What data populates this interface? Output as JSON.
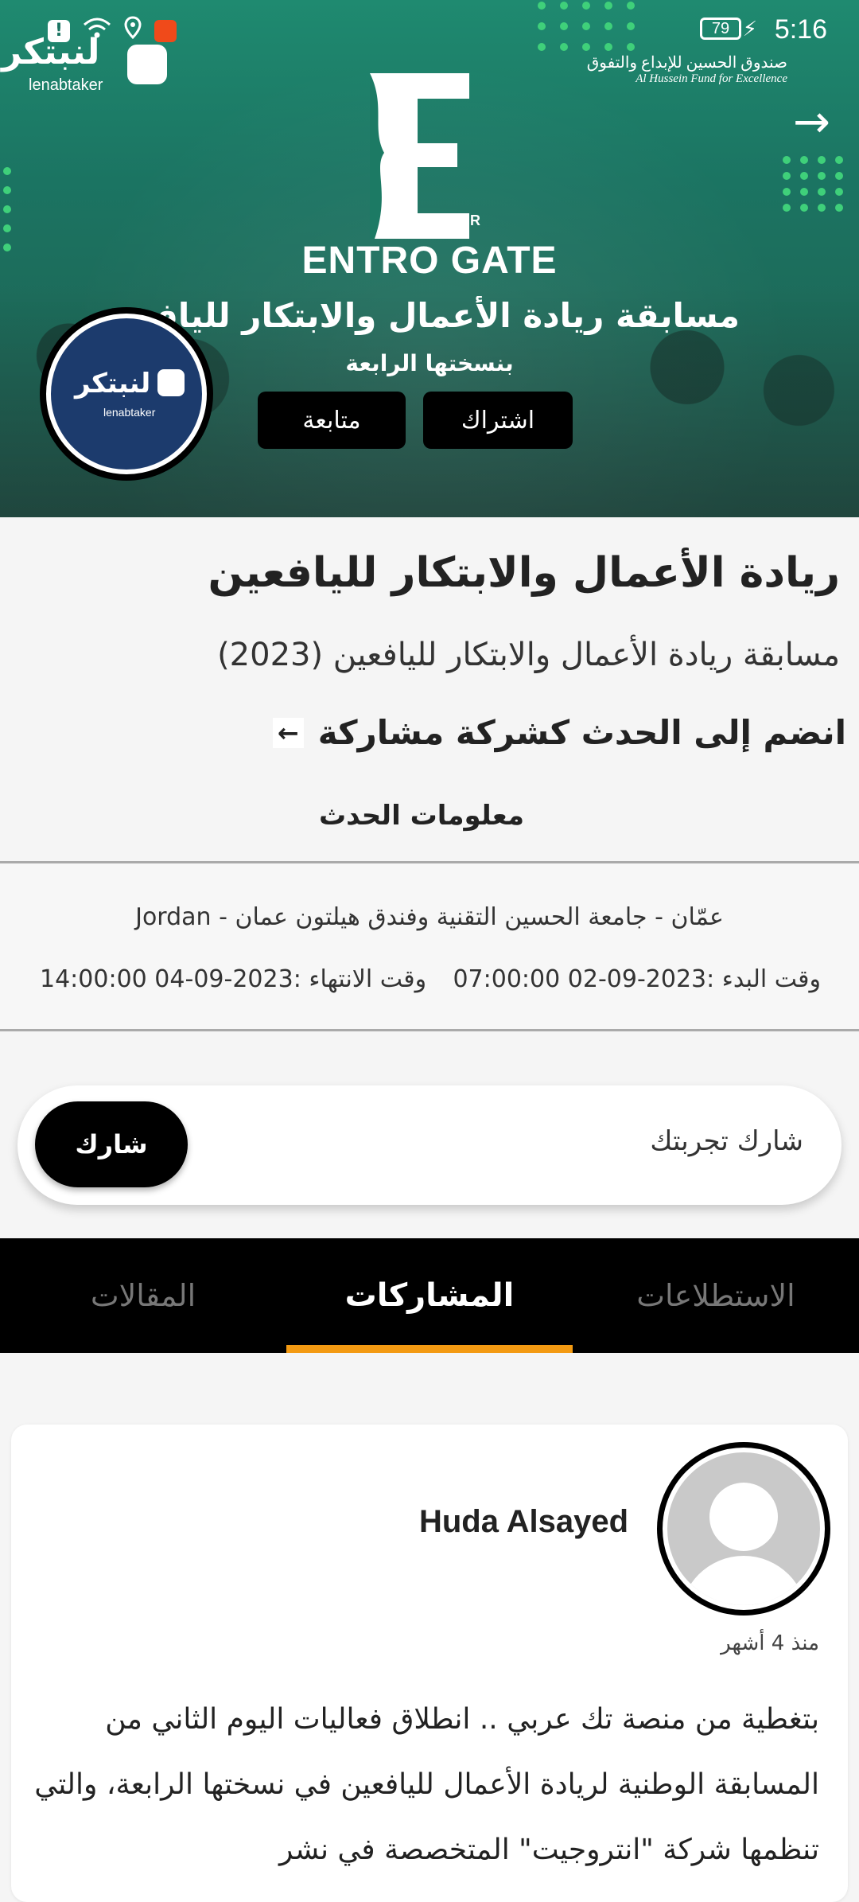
{
  "status_bar": {
    "time": "5:16",
    "battery": "79"
  },
  "hero": {
    "brand_ar": "لنبتكر",
    "brand_en": "lenabtaker",
    "fund_ar": "صندوق الحسين للإبداع والتفوق",
    "fund_en": "Al Hussein Fund for Excellence",
    "event_logo_letter": "E",
    "event_logo_sup": "R",
    "event_name": "ENTRO GATE",
    "title": "مسابقة ريادة الأعمال والابتكار لليافعين",
    "subtitle": "بنسختها الرابعة",
    "subscribe_label": "اشتراك",
    "follow_label": "متابعة"
  },
  "event": {
    "title": "ريادة الأعمال والابتكار لليافعين",
    "subtitle": "مسابقة ريادة الأعمال والابتكار لليافعين (2023)",
    "join_link": "انضم إلى الحدث كشركة مشاركة",
    "join_arrow": "←",
    "info_label": "معلومات الحدث",
    "location": "Jordan - عمّان - جامعة الحسين التقنية وفندق هيلتون عمان",
    "start": "وقت البدء :2023-09-02 07:00:00",
    "end": "وقت الانتهاء :2023-09-04 14:00:00"
  },
  "share": {
    "prompt": "شارك تجربتك",
    "button": "شارك"
  },
  "tabs": [
    {
      "label": "الاستطلاعات"
    },
    {
      "label": "المشاركات"
    },
    {
      "label": "المقالات"
    }
  ],
  "post": {
    "author": "Huda Alsayed",
    "time_ago": "منذ 4 أشهر",
    "text": "بتغطية من منصة تك عربي .. انطلاق فعاليات اليوم الثاني من المسابقة الوطنية لريادة الأعمال لليافعين في نسختها الرابعة، والتي تنظمها شركة \"انتروجيت\" المتخصصة في نشر"
  },
  "colors": {
    "accent": "#f39a12",
    "hero_green": "#1b7462",
    "tab_bar": "#000000"
  }
}
